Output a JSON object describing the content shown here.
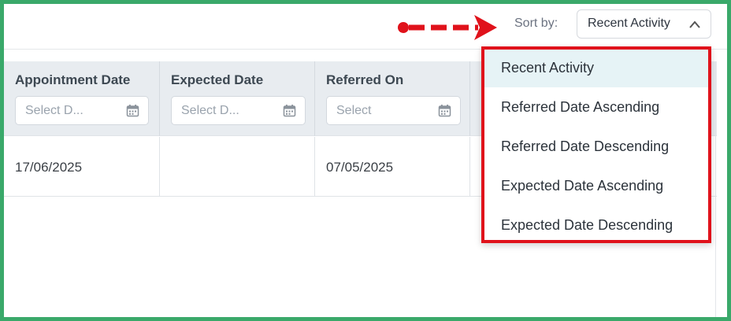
{
  "sort": {
    "label": "Sort by:",
    "selected": "Recent Activity",
    "options": [
      "Recent Activity",
      "Referred Date Ascending",
      "Referred Date Descending",
      "Expected Date Ascending",
      "Expected Date Descending"
    ]
  },
  "table": {
    "columns": [
      {
        "label": "Appointment Date",
        "placeholder": "Select D..."
      },
      {
        "label": "Expected Date",
        "placeholder": "Select D..."
      },
      {
        "label": "Referred On",
        "placeholder": "Select"
      }
    ],
    "rows": [
      [
        "17/06/2025",
        "",
        "07/05/2025"
      ]
    ]
  },
  "colors": {
    "frame": "#3aa96a",
    "highlight": "#e0121b",
    "selected_option_bg": "#e6f3f6"
  }
}
